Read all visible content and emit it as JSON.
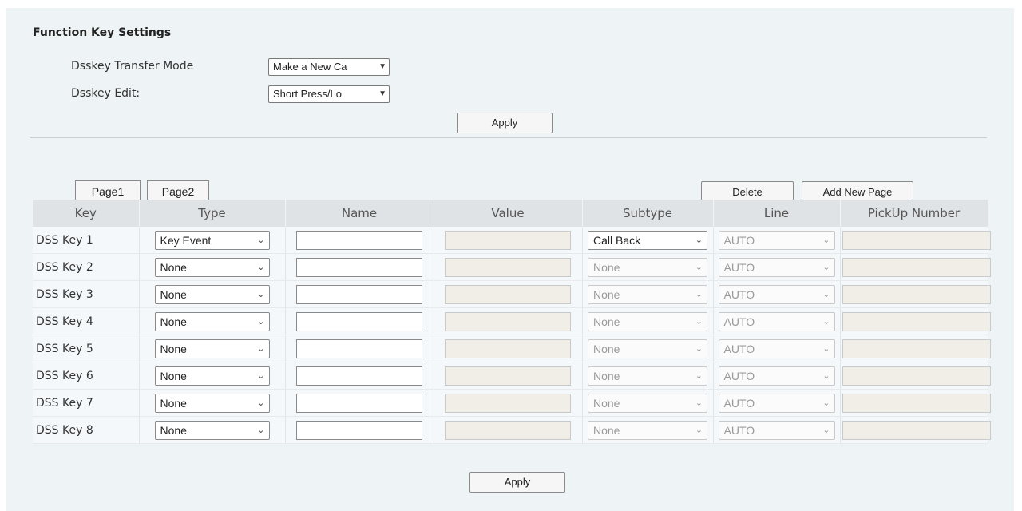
{
  "section_title": "Function Key Settings",
  "transfer_mode": {
    "label": "Dsskey Transfer Mode",
    "value": "Make a New Ca"
  },
  "dsskey_edit": {
    "label": "Dsskey Edit:",
    "value": "Short Press/Lo"
  },
  "apply_top": "Apply",
  "tabs": [
    "Page1",
    "Page2"
  ],
  "delete_label": "Delete",
  "add_page_label": "Add New Page",
  "columns": [
    "Key",
    "Type",
    "Name",
    "Value",
    "Subtype",
    "Line",
    "PickUp Number"
  ],
  "rows": [
    {
      "key": "DSS Key 1",
      "type": "Key Event",
      "subtype": "Call Back",
      "line": "AUTO"
    },
    {
      "key": "DSS Key 2",
      "type": "None",
      "subtype": "None",
      "line": "AUTO"
    },
    {
      "key": "DSS Key 3",
      "type": "None",
      "subtype": "None",
      "line": "AUTO"
    },
    {
      "key": "DSS Key 4",
      "type": "None",
      "subtype": "None",
      "line": "AUTO"
    },
    {
      "key": "DSS Key 5",
      "type": "None",
      "subtype": "None",
      "line": "AUTO"
    },
    {
      "key": "DSS Key 6",
      "type": "None",
      "subtype": "None",
      "line": "AUTO"
    },
    {
      "key": "DSS Key 7",
      "type": "None",
      "subtype": "None",
      "line": "AUTO"
    },
    {
      "key": "DSS Key 8",
      "type": "None",
      "subtype": "None",
      "line": "AUTO"
    }
  ],
  "apply_bottom": "Apply"
}
